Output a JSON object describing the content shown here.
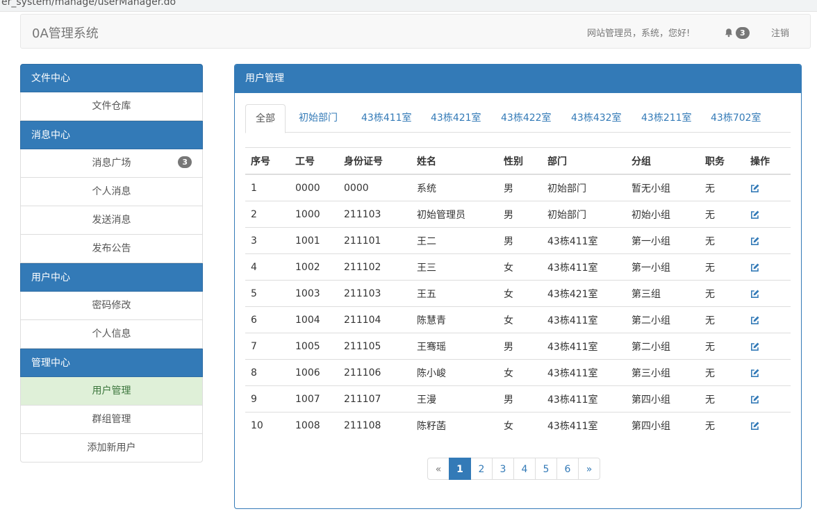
{
  "browser": {
    "url": "er_system/manage/userManager.do"
  },
  "navbar": {
    "brand": "0A管理系统",
    "welcome": "网站管理员，系统，您好!",
    "notification_count": "3",
    "logout": "注销"
  },
  "sidebar": {
    "sections": [
      {
        "title": "文件中心",
        "items": [
          {
            "label": "文件仓库"
          }
        ]
      },
      {
        "title": "消息中心",
        "items": [
          {
            "label": "消息广场",
            "badge": "3"
          },
          {
            "label": "个人消息"
          },
          {
            "label": "发送消息"
          },
          {
            "label": "发布公告"
          }
        ]
      },
      {
        "title": "用户中心",
        "items": [
          {
            "label": "密码修改"
          },
          {
            "label": "个人信息"
          }
        ]
      },
      {
        "title": "管理中心",
        "items": [
          {
            "label": "用户管理",
            "active": true
          },
          {
            "label": "群组管理"
          },
          {
            "label": "添加新用户"
          }
        ]
      }
    ]
  },
  "panel": {
    "title": "用户管理",
    "tabs": [
      "全部",
      "初始部门",
      "43栋411室",
      "43栋421室",
      "43栋422室",
      "43栋432室",
      "43栋211室",
      "43栋702室"
    ],
    "active_tab": 0
  },
  "table": {
    "headers": [
      "序号",
      "工号",
      "身份证号",
      "姓名",
      "性别",
      "部门",
      "分组",
      "职务",
      "操作"
    ],
    "rows": [
      [
        "1",
        "0000",
        "0000",
        "系统",
        "男",
        "初始部门",
        "暂无小组",
        "无"
      ],
      [
        "2",
        "1000",
        "211103",
        "初始管理员",
        "男",
        "初始部门",
        "初始小组",
        "无"
      ],
      [
        "3",
        "1001",
        "211101",
        "王二",
        "男",
        "43栋411室",
        "第一小组",
        "无"
      ],
      [
        "4",
        "1002",
        "211102",
        "王三",
        "女",
        "43栋411室",
        "第一小组",
        "无"
      ],
      [
        "5",
        "1003",
        "211103",
        "王五",
        "女",
        "43栋421室",
        "第三组",
        "无"
      ],
      [
        "6",
        "1004",
        "211104",
        "陈慧青",
        "女",
        "43栋411室",
        "第二小组",
        "无"
      ],
      [
        "7",
        "1005",
        "211105",
        "王骞瑶",
        "男",
        "43栋411室",
        "第二小组",
        "无"
      ],
      [
        "8",
        "1006",
        "211106",
        "陈小峻",
        "女",
        "43栋411室",
        "第三小组",
        "无"
      ],
      [
        "9",
        "1007",
        "211107",
        "王漫",
        "男",
        "43栋411室",
        "第四小组",
        "无"
      ],
      [
        "10",
        "1008",
        "211108",
        "陈籽菡",
        "女",
        "43栋411室",
        "第四小组",
        "无"
      ]
    ]
  },
  "pagination": {
    "prev": "«",
    "pages": [
      "1",
      "2",
      "3",
      "4",
      "5",
      "6"
    ],
    "active": "1",
    "next": "»"
  },
  "colors": {
    "primary": "#337ab7",
    "active_bg": "#dff0d8",
    "badge": "#777777"
  }
}
